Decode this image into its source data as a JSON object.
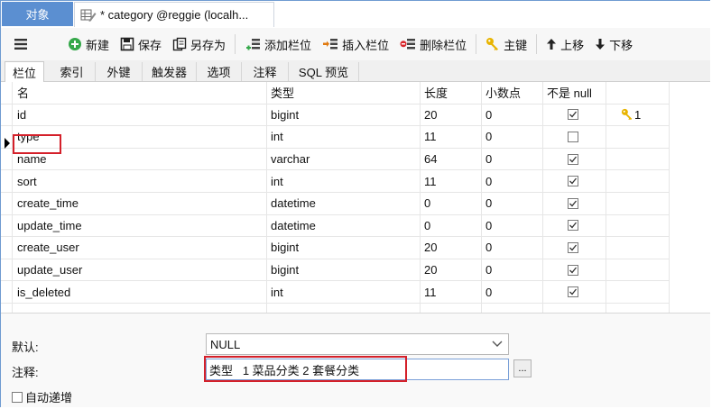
{
  "tabs": {
    "objects": "对象",
    "editor": "* category @reggie (localh..."
  },
  "toolbar": {
    "new": "新建",
    "save": "保存",
    "save_as": "另存为",
    "add_column": "添加栏位",
    "insert_column": "插入栏位",
    "delete_column": "删除栏位",
    "primary_key": "主键",
    "move_up": "上移",
    "move_down": "下移"
  },
  "subtabs": [
    "栏位",
    "索引",
    "外键",
    "触发器",
    "选项",
    "注释",
    "SQL 预览"
  ],
  "columns": {
    "name": "名",
    "type": "类型",
    "length": "长度",
    "decimals": "小数点",
    "not_null": "不是 null"
  },
  "rows": [
    {
      "name": "id",
      "type": "bigint",
      "length": "20",
      "decimals": "0",
      "not_null": true,
      "key": "1"
    },
    {
      "name": "type",
      "type": "int",
      "length": "11",
      "decimals": "0",
      "not_null": false,
      "key": ""
    },
    {
      "name": "name",
      "type": "varchar",
      "length": "64",
      "decimals": "0",
      "not_null": true,
      "key": ""
    },
    {
      "name": "sort",
      "type": "int",
      "length": "11",
      "decimals": "0",
      "not_null": true,
      "key": ""
    },
    {
      "name": "create_time",
      "type": "datetime",
      "length": "0",
      "decimals": "0",
      "not_null": true,
      "key": ""
    },
    {
      "name": "update_time",
      "type": "datetime",
      "length": "0",
      "decimals": "0",
      "not_null": true,
      "key": ""
    },
    {
      "name": "create_user",
      "type": "bigint",
      "length": "20",
      "decimals": "0",
      "not_null": true,
      "key": ""
    },
    {
      "name": "update_user",
      "type": "bigint",
      "length": "20",
      "decimals": "0",
      "not_null": true,
      "key": ""
    },
    {
      "name": "is_deleted",
      "type": "int",
      "length": "11",
      "decimals": "0",
      "not_null": true,
      "key": ""
    }
  ],
  "props": {
    "default_label": "默认:",
    "default_value": "NULL",
    "comment_label": "注释:",
    "comment_value": "类型   1 菜品分类 2 套餐分类",
    "browse": "...",
    "auto_increment_label": "自动递增"
  },
  "colors": {
    "accent_tab": "#5b8fd1",
    "highlight": "#d4202a",
    "key_icon": "#e0a800"
  }
}
